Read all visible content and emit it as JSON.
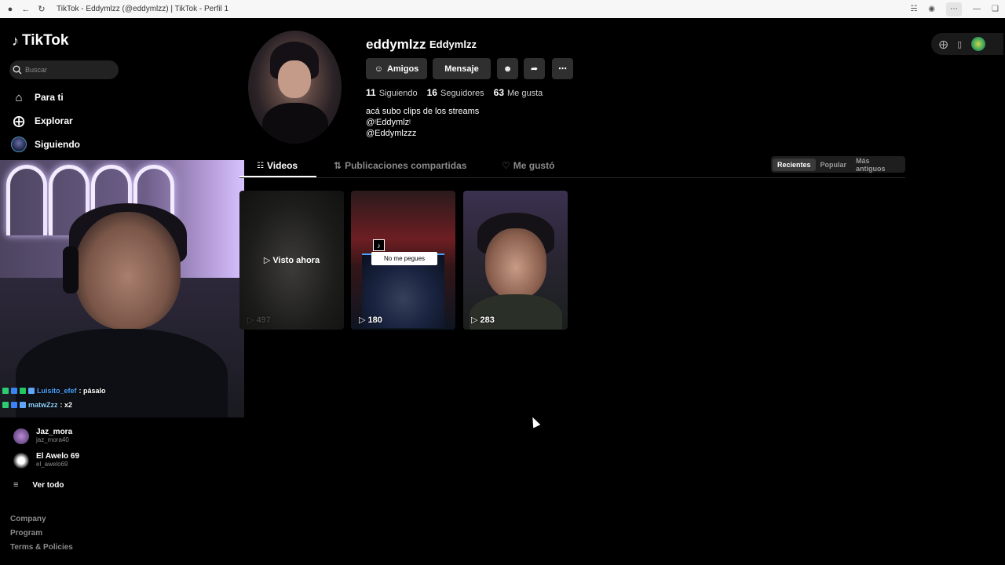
{
  "browser": {
    "title": "TikTok - Eddymlzz (@eddymlzz) | TikTok - Perfil 1"
  },
  "sidebar": {
    "logo": "TikTok",
    "search_placeholder": "Buscar",
    "nav": [
      {
        "label": "Para ti",
        "icon": "home-icon"
      },
      {
        "label": "Explorar",
        "icon": "compass-icon"
      },
      {
        "label": "Siguiendo",
        "icon": "avatar"
      }
    ],
    "following": [
      {
        "name": "Jaz_mora",
        "handle": "jaz_mora40"
      },
      {
        "name": "El Awelo 69",
        "handle": "el_awelo69"
      }
    ],
    "see_all": "Ver todo",
    "footer": [
      "Company",
      "Program",
      "Terms & Policies"
    ]
  },
  "overlay": {
    "chat": [
      {
        "user": "Luisito_efef",
        "message": ": pásalo",
        "color": "#4aa3ff"
      },
      {
        "user": "matwZzz",
        "message": ": x2",
        "color": "#8fd3ff"
      }
    ]
  },
  "profile": {
    "username": "eddymlzz",
    "nickname": "Eddymlzz",
    "buttons": {
      "friends": "Amigos",
      "message": "Mensaje"
    },
    "stats": [
      {
        "value": "11",
        "label": "Siguiendo"
      },
      {
        "value": "16",
        "label": "Seguidores"
      },
      {
        "value": "63",
        "label": "Me gusta"
      }
    ],
    "bio": [
      "acá subo clips de los streams",
      "@ᵎEddymlzᵎ",
      "@Eddymlzzz"
    ]
  },
  "tabs": [
    {
      "label": "Videos",
      "icon": "grid-icon",
      "active": true
    },
    {
      "label": "Publicaciones compartidas",
      "icon": "repost-icon",
      "active": false
    },
    {
      "label": "Me gustó",
      "icon": "heart-icon",
      "active": false
    }
  ],
  "sort": [
    "Recientes",
    "Popular",
    "Más antiguos"
  ],
  "videos": [
    {
      "views": "497",
      "overlay": "Visto ahora"
    },
    {
      "views": "180",
      "caption": "No me pegues"
    },
    {
      "views": "283"
    }
  ]
}
